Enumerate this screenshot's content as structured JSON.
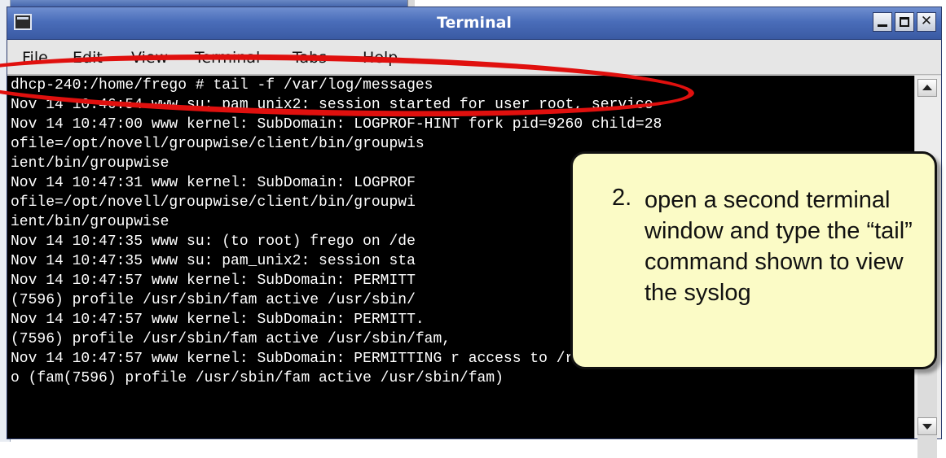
{
  "window": {
    "title": "Terminal"
  },
  "menu": [
    "File",
    "Edit",
    "View",
    "Terminal",
    "Tabs",
    "Help"
  ],
  "terminal": {
    "lines": [
      "dhcp-240:/home/frego # tail -f /var/log/messages",
      "Nov 14 10:46:54 www su: pam_unix2: session started for user root, service",
      "Nov 14 10:47:00 www kernel: SubDomain: LOGPROF-HINT fork pid=9260 child=28",
      "ofile=/opt/novell/groupwise/client/bin/groupwis",
      "ient/bin/groupwise",
      "Nov 14 10:47:31 www kernel: SubDomain: LOGPROF",
      "ofile=/opt/novell/groupwise/client/bin/groupwi",
      "ient/bin/groupwise",
      "Nov 14 10:47:35 www su: (to root) frego on /de",
      "Nov 14 10:47:35 www su: pam_unix2: session sta",
      "Nov 14 10:47:57 www kernel: SubDomain: PERMITT",
      "(7596) profile /usr/sbin/fam active /usr/sbin/",
      "Nov 14 10:47:57 www kernel: SubDomain: PERMITT.",
      "(7596) profile /usr/sbin/fam active /usr/sbin/fam,",
      "Nov 14 10:47:57 www kernel: SubDomain: PERMITTING r access to /root/.confi",
      "o (fam(7596) profile /usr/sbin/fam active /usr/sbin/fam)"
    ]
  },
  "callout": {
    "number": "2.",
    "text": "open a second terminal window and type the “tail” command shown to view the syslog"
  },
  "colors": {
    "highlight": "#e0100e",
    "callout_bg": "#fbfbc6",
    "title_bar": "#4a6db9"
  }
}
